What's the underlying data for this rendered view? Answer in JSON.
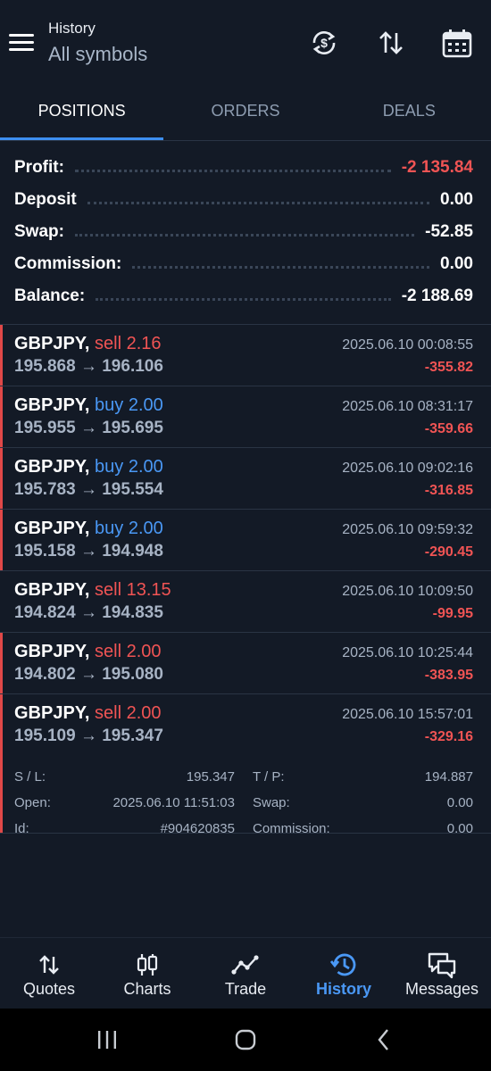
{
  "header": {
    "title": "History",
    "subtitle": "All symbols"
  },
  "tabs": [
    "POSITIONS",
    "ORDERS",
    "DEALS"
  ],
  "summary": [
    {
      "label": "Profit:",
      "value": "-2 135.84",
      "negative": true
    },
    {
      "label": "Deposit",
      "value": "0.00",
      "negative": false
    },
    {
      "label": "Swap:",
      "value": "-52.85",
      "negative": false
    },
    {
      "label": "Commission:",
      "value": "0.00",
      "negative": false
    },
    {
      "label": "Balance:",
      "value": "-2 188.69",
      "negative": false
    }
  ],
  "deals": [
    {
      "symbol": "GBPJPY,",
      "side": "sell",
      "volume": "2.16",
      "prices": "195.868 → 196.106",
      "time": "2025.06.10 00:08:55",
      "profit": "-355.82",
      "loss_marker": true
    },
    {
      "symbol": "GBPJPY,",
      "side": "buy",
      "volume": "2.00",
      "prices": "195.955 → 195.695",
      "time": "2025.06.10 08:31:17",
      "profit": "-359.66",
      "loss_marker": true
    },
    {
      "symbol": "GBPJPY,",
      "side": "buy",
      "volume": "2.00",
      "prices": "195.783 → 195.554",
      "time": "2025.06.10 09:02:16",
      "profit": "-316.85",
      "loss_marker": true
    },
    {
      "symbol": "GBPJPY,",
      "side": "buy",
      "volume": "2.00",
      "prices": "195.158 → 194.948",
      "time": "2025.06.10 09:59:32",
      "profit": "-290.45",
      "loss_marker": true
    },
    {
      "symbol": "GBPJPY,",
      "side": "sell",
      "volume": "13.15",
      "prices": "194.824 → 194.835",
      "time": "2025.06.10 10:09:50",
      "profit": "-99.95",
      "loss_marker": false
    },
    {
      "symbol": "GBPJPY,",
      "side": "sell",
      "volume": "2.00",
      "prices": "194.802 → 195.080",
      "time": "2025.06.10 10:25:44",
      "profit": "-383.95",
      "loss_marker": true
    },
    {
      "symbol": "GBPJPY,",
      "side": "sell",
      "volume": "2.00",
      "prices": "195.109 → 195.347",
      "time": "2025.06.10 15:57:01",
      "profit": "-329.16",
      "loss_marker": true
    }
  ],
  "expanded_details": {
    "sl_label": "S / L:",
    "sl_value": "195.347",
    "tp_label": "T / P:",
    "tp_value": "194.887",
    "open_label": "Open:",
    "open_value": "2025.06.10 11:51:03",
    "swap_label": "Swap:",
    "swap_value": "0.00",
    "id_label": "Id:",
    "id_value": "#904620835",
    "commission_label": "Commission:",
    "commission_value": "0.00"
  },
  "bottom_nav": [
    {
      "label": "Quotes",
      "icon": "quotes-arrows-icon",
      "active": false
    },
    {
      "label": "Charts",
      "icon": "candlestick-icon",
      "active": false
    },
    {
      "label": "Trade",
      "icon": "trade-line-icon",
      "active": false
    },
    {
      "label": "History",
      "icon": "history-clock-icon",
      "active": true
    },
    {
      "label": "Messages",
      "icon": "chat-bubbles-icon",
      "active": false
    }
  ],
  "colors": {
    "background": "#131a26",
    "accent": "#3d8ff0",
    "negative": "#f05454",
    "buy": "#4a98f5",
    "muted": "#a7b3c4"
  }
}
